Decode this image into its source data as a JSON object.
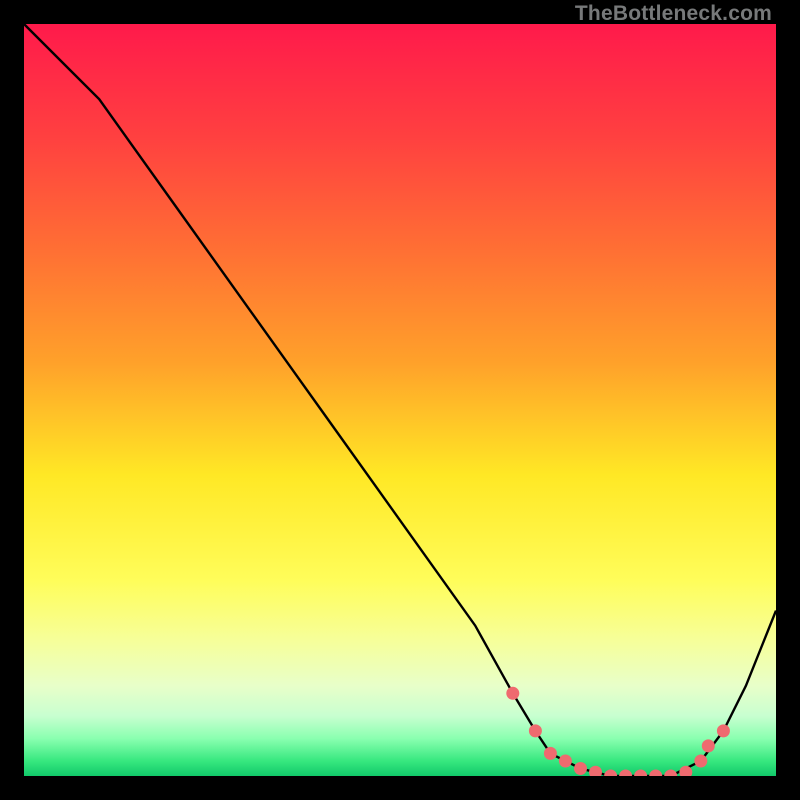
{
  "watermark": "TheBottleneck.com",
  "chart_data": {
    "type": "line",
    "title": "",
    "xlabel": "",
    "ylabel": "",
    "xlim": [
      0,
      100
    ],
    "ylim": [
      0,
      100
    ],
    "gradient_bands": [
      {
        "y": 0,
        "color": "#ff1a4b"
      },
      {
        "y": 15,
        "color": "#ff4040"
      },
      {
        "y": 30,
        "color": "#ff6f34"
      },
      {
        "y": 45,
        "color": "#ffa12a"
      },
      {
        "y": 60,
        "color": "#ffe825"
      },
      {
        "y": 74,
        "color": "#fffd5a"
      },
      {
        "y": 82,
        "color": "#f6ff9a"
      },
      {
        "y": 88,
        "color": "#e8ffc9"
      },
      {
        "y": 92,
        "color": "#c8ffd0"
      },
      {
        "y": 95,
        "color": "#8affb0"
      },
      {
        "y": 98,
        "color": "#37e87f"
      },
      {
        "y": 100,
        "color": "#11c96a"
      }
    ],
    "series": [
      {
        "name": "bottleneck-curve",
        "color": "#000000",
        "x": [
          0,
          6,
          10,
          20,
          30,
          40,
          50,
          60,
          65,
          68,
          70,
          74,
          78,
          82,
          86,
          90,
          93,
          96,
          100
        ],
        "y": [
          100,
          94,
          90,
          76,
          62,
          48,
          34,
          20,
          11,
          6,
          3,
          1,
          0,
          0,
          0,
          2,
          6,
          12,
          22
        ]
      }
    ],
    "markers": {
      "name": "highlight-dots",
      "color": "#ef6a6f",
      "x": [
        65,
        68,
        70,
        72,
        74,
        76,
        78,
        80,
        82,
        84,
        86,
        88,
        90,
        91,
        93
      ],
      "y": [
        11,
        6,
        3,
        2,
        1,
        0.5,
        0,
        0,
        0,
        0,
        0,
        0.5,
        2,
        4,
        6
      ]
    }
  }
}
